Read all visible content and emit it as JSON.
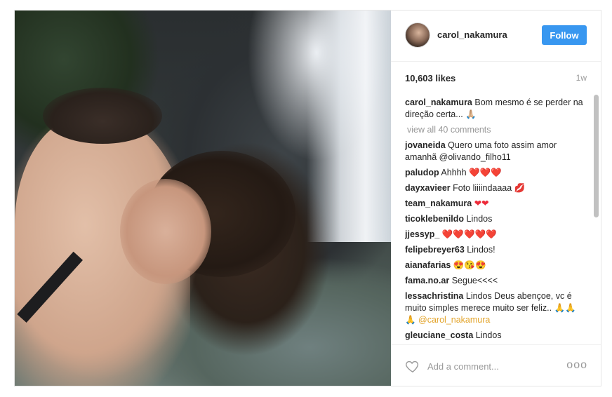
{
  "post": {
    "username": "carol_nakamura",
    "follow_label": "Follow",
    "likes": "10,603 likes",
    "time": "1w",
    "caption": {
      "user": "carol_nakamura",
      "text": "Bom mesmo é se perder na direção certa...",
      "emoji": "🙏🏼"
    },
    "view_all": "view all 40 comments",
    "comments": [
      {
        "user": "jovaneida",
        "text": "Quero uma foto assim amor amanhã @olivando_filho11",
        "emoji": ""
      },
      {
        "user": "paludop",
        "text": "Ahhhh",
        "emoji": "❤️❤️❤️"
      },
      {
        "user": "dayxavieer",
        "text": "Foto liiiindaaaa",
        "emoji": "💋"
      },
      {
        "user": "team_nakamura",
        "text": "",
        "emoji": "❤❤"
      },
      {
        "user": "ticoklebenildo",
        "text": "Lindos",
        "emoji": ""
      },
      {
        "user": "jjessyp_",
        "text": "",
        "emoji": "❤️❤️❤️❤️❤️"
      },
      {
        "user": "felipebreyer63",
        "text": "Lindos!",
        "emoji": ""
      },
      {
        "user": "aianafarias",
        "text": "",
        "emoji": "😍😘😍"
      },
      {
        "user": "fama.no.ar",
        "text": "Segue<<<<",
        "emoji": ""
      },
      {
        "user": "lessachristina",
        "text": "Lindos Deus abençoe, vc é muito simples merece muito ser feliz..",
        "emoji": "🙏🙏🙏 @carol_nakamura"
      },
      {
        "user": "gleuciane_costa",
        "text": "Lindos",
        "emoji": ""
      }
    ],
    "add_comment_placeholder": "Add a comment...",
    "more_label": "ooo"
  }
}
